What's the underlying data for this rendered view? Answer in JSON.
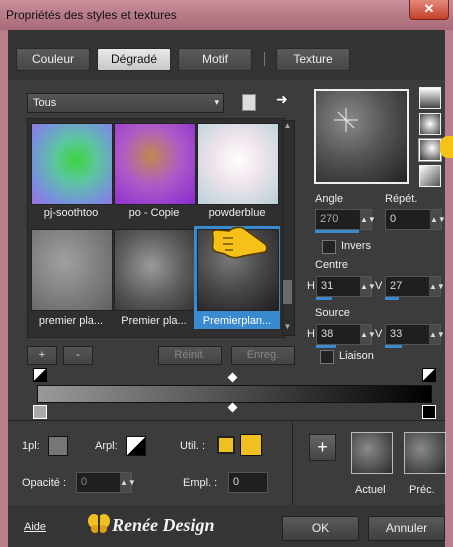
{
  "window": {
    "title": "Propriétés des styles et textures",
    "close": "✕"
  },
  "tabs": [
    {
      "label": "Couleur"
    },
    {
      "label": "Dégradé"
    },
    {
      "label": "Motif"
    },
    {
      "label": "Texture"
    }
  ],
  "library": {
    "combo_value": "Tous",
    "combo_arrow": "▾",
    "nav_arrow": "➜"
  },
  "thumbnails": [
    {
      "label": "pj-soothtoo"
    },
    {
      "label": "po - Copie"
    },
    {
      "label": "powderblue"
    },
    {
      "label": "premier pla..."
    },
    {
      "label": "Premier pla..."
    },
    {
      "label": "Premierplan..."
    }
  ],
  "buttons": {
    "add": "+",
    "remove": "-",
    "reset": "Réinit.",
    "save": "Enreg."
  },
  "angle": {
    "label": "Angle",
    "value": "270"
  },
  "repeat": {
    "label": "Répét.",
    "value": "0"
  },
  "invert": {
    "label": "Invers"
  },
  "centre": {
    "label": "Centre",
    "h_label": "H",
    "h_value": "31",
    "v_label": "V",
    "v_value": "27"
  },
  "source": {
    "label": "Source",
    "h_label": "H",
    "h_value": "38",
    "v_label": "V",
    "v_value": "33"
  },
  "link_label": "Liaison",
  "bottom": {
    "first_plan_label": "1pl:",
    "back_plan_label": "Arpl:",
    "use_label": "Util. :",
    "opacity_label": "Opacité :",
    "opacity_value": "0",
    "location_label": "Empl. :",
    "location_value": "0",
    "plus": "+",
    "current_label": "Actuel",
    "previous_label": "Préc."
  },
  "footer": {
    "help": "Aide",
    "brand": "Renée Design",
    "ok": "OK",
    "cancel": "Annuler"
  },
  "colors": {
    "accent": "#3a8ad0",
    "swatch": "#f0c020"
  }
}
